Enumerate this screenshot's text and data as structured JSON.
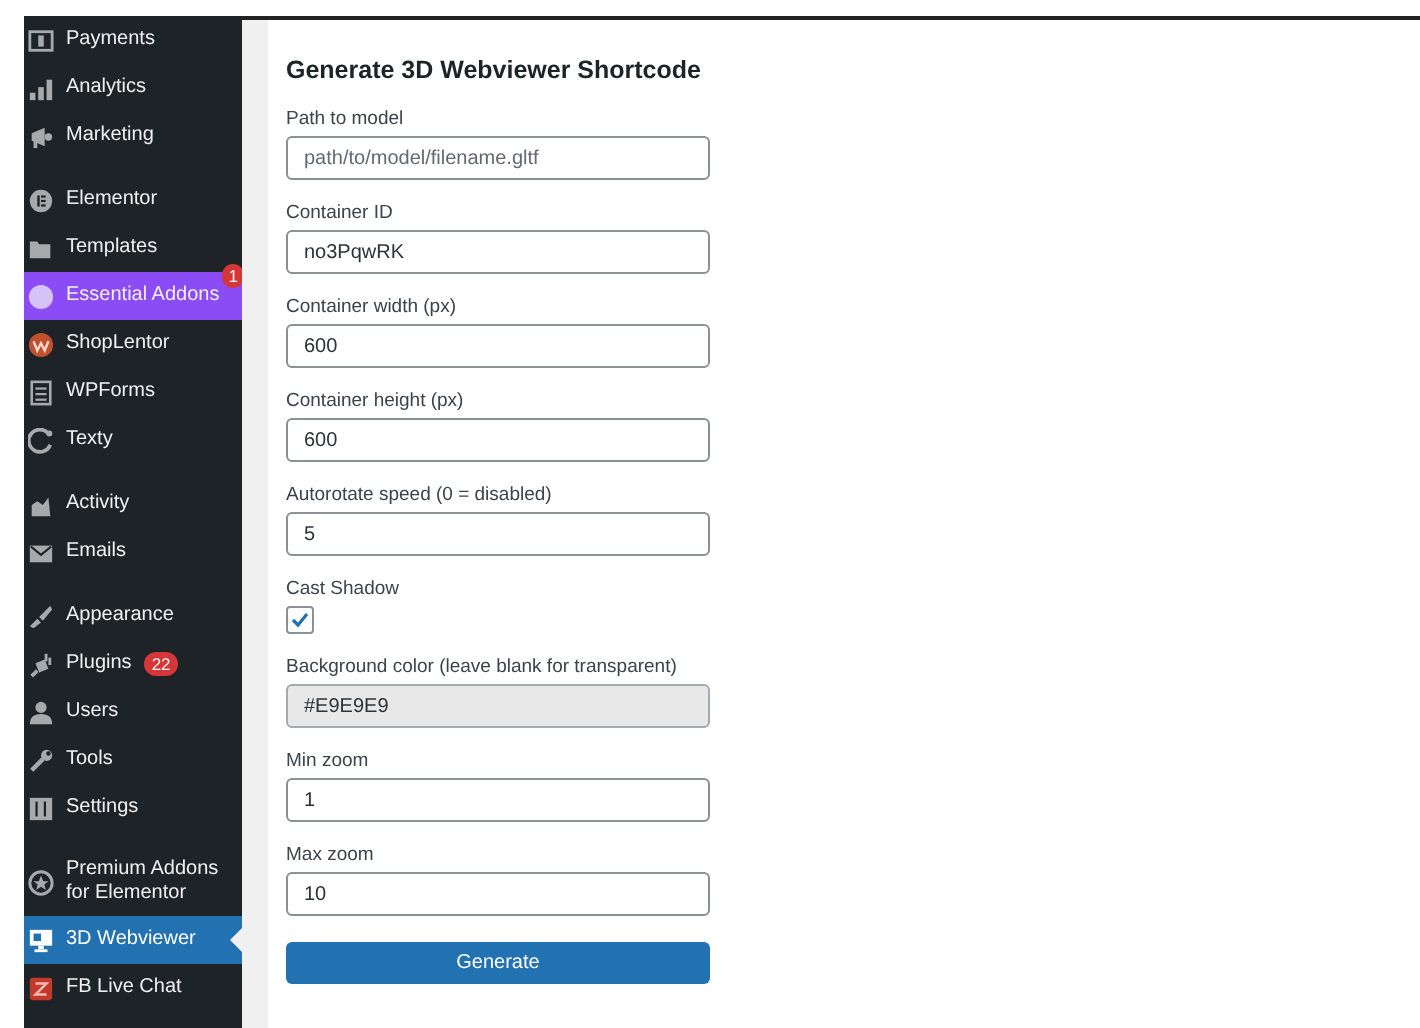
{
  "sidebar": {
    "groups": [
      [
        {
          "label": "Payments",
          "selected": false
        },
        {
          "label": "Analytics",
          "selected": false
        },
        {
          "label": "Marketing",
          "selected": false
        }
      ],
      [
        {
          "label": "Elementor",
          "selected": false
        },
        {
          "label": "Templates",
          "selected": false
        },
        {
          "label": "Essential Addons",
          "selected": false,
          "color": "#8c4cf5",
          "badge": "1"
        },
        {
          "label": "ShopLentor",
          "selected": false
        },
        {
          "label": "WPForms",
          "selected": false
        },
        {
          "label": "Texty",
          "selected": false
        }
      ],
      [
        {
          "label": "Activity",
          "selected": false
        },
        {
          "label": "Emails",
          "selected": false
        }
      ],
      [
        {
          "label": "Appearance",
          "selected": false
        },
        {
          "label": "Plugins",
          "selected": false,
          "badge": "22"
        },
        {
          "label": "Users",
          "selected": false
        },
        {
          "label": "Tools",
          "selected": false
        },
        {
          "label": "Settings",
          "selected": false
        }
      ],
      [
        {
          "label": "Premium Addons for Elementor",
          "selected": false
        },
        {
          "label": "3D Webviewer",
          "selected": true
        },
        {
          "label": "FB Live Chat",
          "selected": false
        }
      ]
    ]
  },
  "form": {
    "title": "Generate 3D Webviewer Shortcode",
    "fields": [
      {
        "kind": "text",
        "label": "Path to model",
        "placeholder": "path/to/model/filename.gltf",
        "disabled": false
      },
      {
        "kind": "text",
        "label": "Container ID",
        "value": "no3PqwRK",
        "disabled": false
      },
      {
        "kind": "text",
        "label": "Container width (px)",
        "value": "600",
        "disabled": false
      },
      {
        "kind": "text",
        "label": "Container height (px)",
        "value": "600",
        "disabled": false
      },
      {
        "kind": "text",
        "label": "Autorotate speed (0 = disabled)",
        "value": "5",
        "disabled": false
      },
      {
        "kind": "checkbox",
        "label": "Cast Shadow",
        "checked": true
      },
      {
        "kind": "text",
        "label": "Background color (leave blank for transparent)",
        "value": "#E9E9E9",
        "disabled": true
      },
      {
        "kind": "text",
        "label": "Min zoom",
        "value": "1",
        "disabled": false
      },
      {
        "kind": "text",
        "label": "Max zoom",
        "value": "10",
        "disabled": false
      }
    ],
    "button": "Generate"
  }
}
